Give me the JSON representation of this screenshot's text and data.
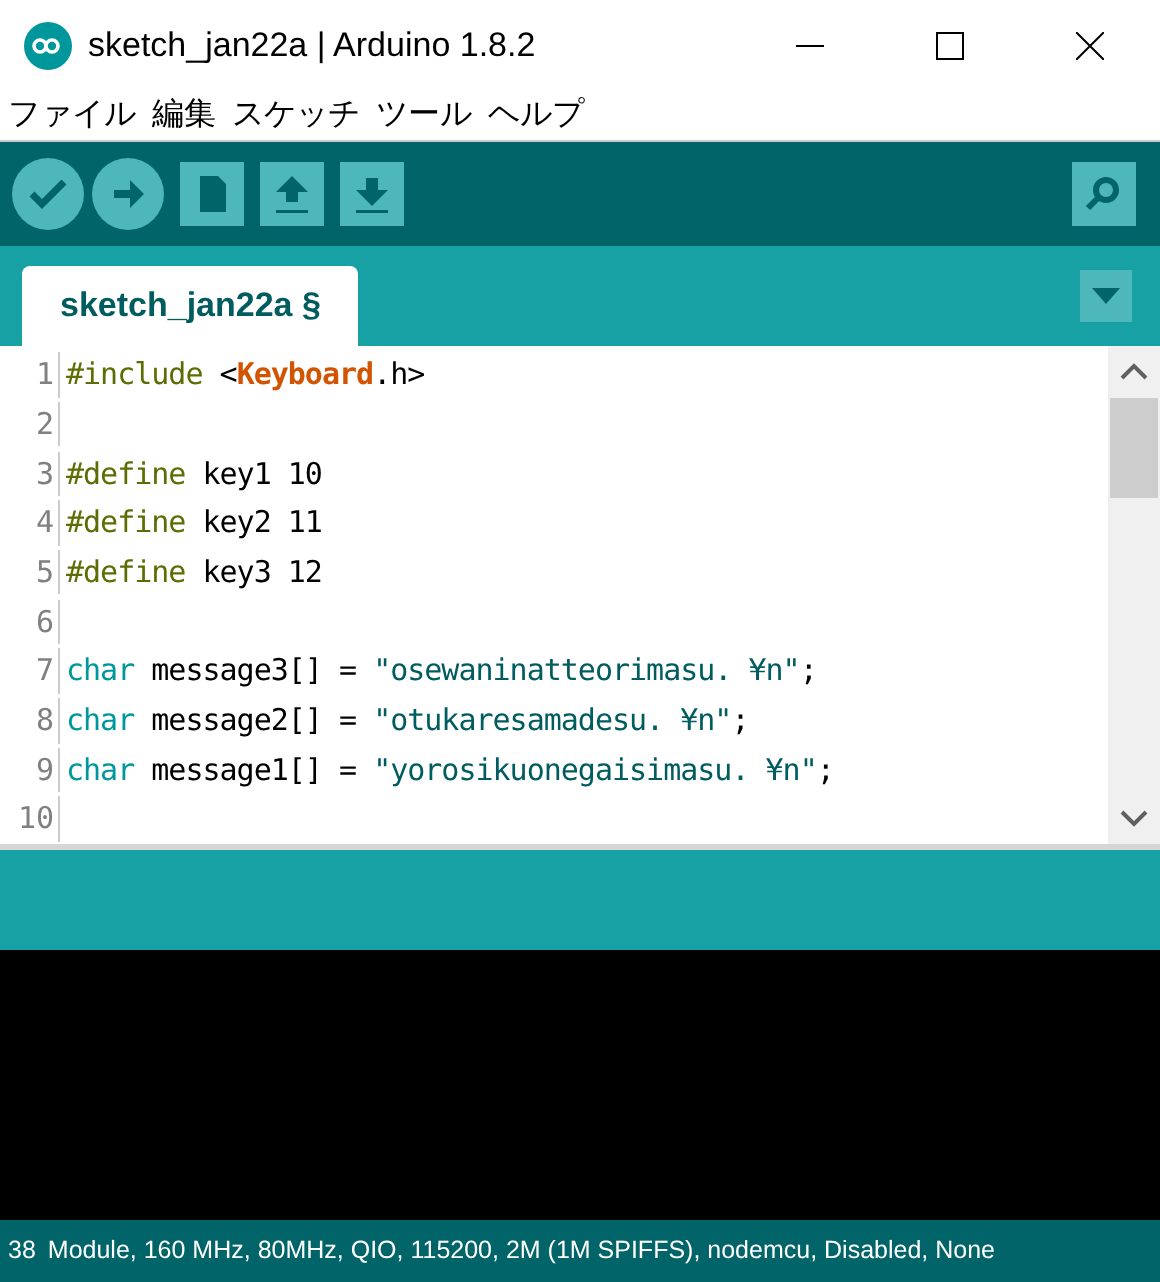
{
  "window": {
    "title": "sketch_jan22a | Arduino 1.8.2"
  },
  "menu": [
    "ファイル",
    "編集",
    "スケッチ",
    "ツール",
    "ヘルプ"
  ],
  "toolbar": [
    {
      "kind": "verify"
    },
    {
      "kind": "upload"
    },
    {
      "kind": "new"
    },
    {
      "kind": "open"
    },
    {
      "kind": "save"
    }
  ],
  "tabs": [
    {
      "label": "sketch_jan22a §",
      "selected": true
    }
  ],
  "editor": {
    "lines": [
      {
        "number": "1",
        "tokens": [
          {
            "kind": "preproc",
            "text": "#include"
          },
          {
            "kind": "plain",
            "text": " <"
          },
          {
            "kind": "library",
            "text": "Keyboard"
          },
          {
            "kind": "plain",
            "text": ".h>"
          }
        ]
      },
      {
        "number": "2"
      },
      {
        "number": "3",
        "tokens": [
          {
            "kind": "preproc",
            "text": "#define"
          },
          {
            "kind": "plain",
            "text": " key1 10"
          }
        ]
      },
      {
        "number": "4",
        "tokens": [
          {
            "kind": "preproc",
            "text": "#define"
          },
          {
            "kind": "plain",
            "text": " key2 11"
          }
        ]
      },
      {
        "number": "5",
        "tokens": [
          {
            "kind": "preproc",
            "text": "#define"
          },
          {
            "kind": "plain",
            "text": " key3 12"
          }
        ]
      },
      {
        "number": "6"
      },
      {
        "number": "7",
        "tokens": [
          {
            "kind": "type",
            "text": "char"
          },
          {
            "kind": "plain",
            "text": " message3[] = "
          },
          {
            "kind": "string",
            "text": "\"osewaninatteorimasu. ¥n\""
          },
          {
            "kind": "plain",
            "text": ";"
          }
        ]
      },
      {
        "number": "8",
        "tokens": [
          {
            "kind": "type",
            "text": "char"
          },
          {
            "kind": "plain",
            "text": " message2[] = "
          },
          {
            "kind": "string",
            "text": "\"otukaresamadesu. ¥n\""
          },
          {
            "kind": "plain",
            "text": ";"
          }
        ]
      },
      {
        "number": "9",
        "tokens": [
          {
            "kind": "type",
            "text": "char"
          },
          {
            "kind": "plain",
            "text": " message1[] = "
          },
          {
            "kind": "string",
            "text": "\"yorosikuonegaisimasu. ¥n\""
          },
          {
            "kind": "plain",
            "text": ";"
          }
        ]
      },
      {
        "number": "10"
      }
    ]
  },
  "status_bar": {
    "line": "38",
    "board": "Module, 160 MHz, 80MHz, QIO, 115200, 2M (1M SPIFFS), nodemcu, Disabled, None"
  }
}
